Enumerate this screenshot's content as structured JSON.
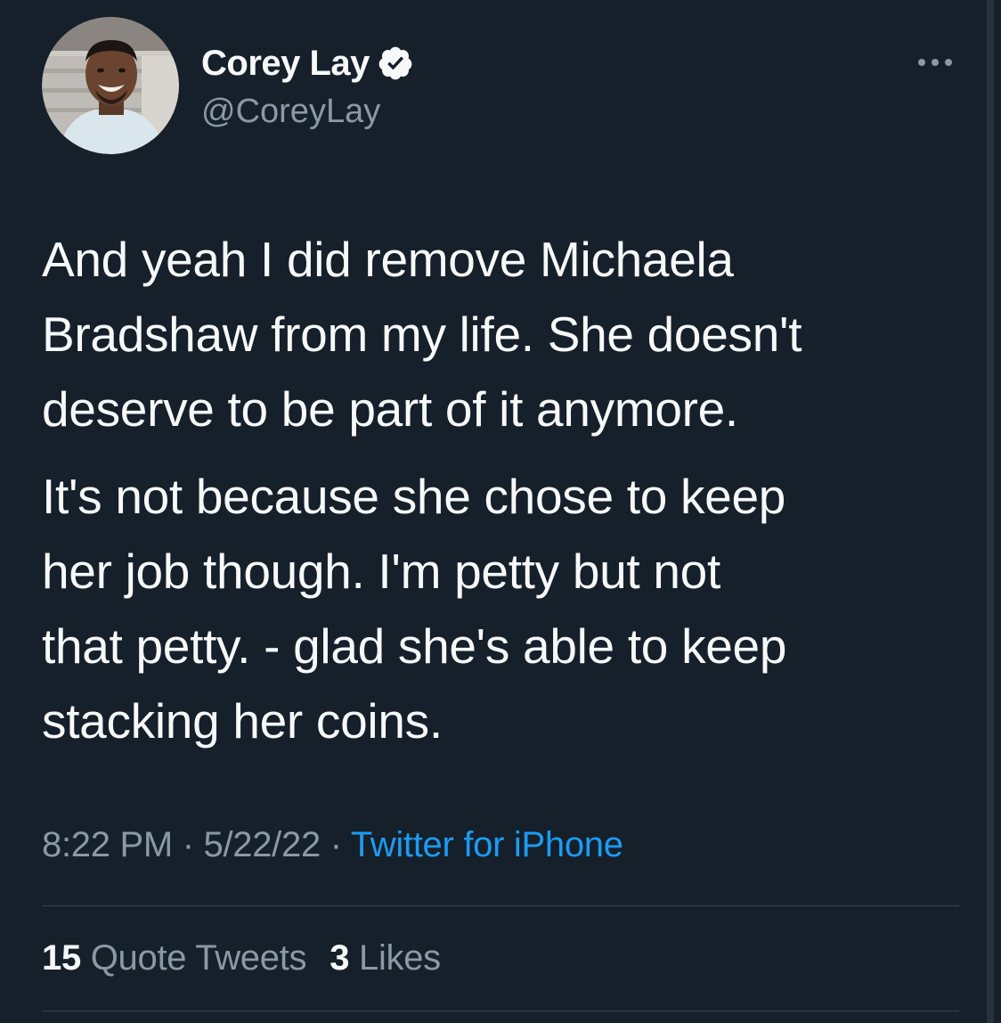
{
  "user": {
    "display_name": "Corey Lay",
    "handle": "@CoreyLay",
    "verified": true
  },
  "tweet": {
    "paragraphs": [
      "And yeah I did remove Michaela\nBradshaw from my life. She doesn't\ndeserve to be part of it anymore.",
      "It's not because she chose to keep\nher job though. I'm petty but not\nthat petty. - glad she's able to keep\nstacking her coins."
    ],
    "time": "8:22 PM",
    "separator": " · ",
    "date": "5/22/22",
    "source": "Twitter for iPhone"
  },
  "stats": {
    "quote_tweets_count": "15",
    "quote_tweets_label": "Quote Tweets",
    "likes_count": "3",
    "likes_label": "Likes"
  },
  "icons": {
    "verified": "verified-badge-icon",
    "more": "more-options-icon"
  },
  "colors": {
    "background": "#15202b",
    "text_primary": "#f7f9f9",
    "text_secondary": "#8b98a5",
    "link": "#1d9bf0",
    "divider": "#38444d"
  }
}
